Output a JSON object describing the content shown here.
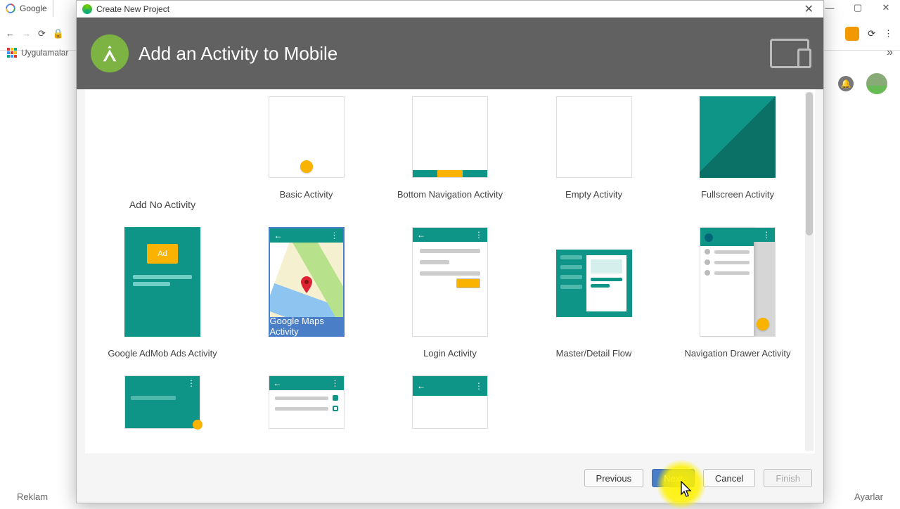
{
  "browser": {
    "tab_label": "Google",
    "bookmarks_label": "Uygulamalar",
    "footer_left": "Reklam",
    "footer_right": "Ayarlar"
  },
  "dialog": {
    "titlebar": "Create New Project",
    "header_title": "Add an Activity to Mobile",
    "selected_index": 6,
    "tiles": [
      {
        "id": "no-activity",
        "label": "Add No Activity",
        "kind": "none"
      },
      {
        "id": "basic",
        "label": "Basic Activity",
        "kind": "basic"
      },
      {
        "id": "bottom-nav",
        "label": "Bottom Navigation Activity",
        "kind": "botnav"
      },
      {
        "id": "empty",
        "label": "Empty Activity",
        "kind": "empty"
      },
      {
        "id": "fullscreen",
        "label": "Fullscreen Activity",
        "kind": "fullscreen"
      },
      {
        "id": "admob",
        "label": "Google AdMob Ads Activity",
        "kind": "admob",
        "ad_text": "Ad"
      },
      {
        "id": "maps",
        "label": "Google Maps Activity",
        "kind": "maps"
      },
      {
        "id": "login",
        "label": "Login Activity",
        "kind": "login"
      },
      {
        "id": "masterdetail",
        "label": "Master/Detail Flow",
        "kind": "masterdetail"
      },
      {
        "id": "navdrawer",
        "label": "Navigation Drawer Activity",
        "kind": "navdrawer"
      },
      {
        "id": "scrolling",
        "label": "",
        "kind": "scrolling"
      },
      {
        "id": "settings",
        "label": "",
        "kind": "settings"
      },
      {
        "id": "tabbed",
        "label": "",
        "kind": "tabbed"
      }
    ],
    "buttons": {
      "previous": "Previous",
      "next": "Next",
      "cancel": "Cancel",
      "finish": "Finish"
    }
  },
  "colors": {
    "teal": "#0f9587",
    "amber": "#f9b300",
    "select": "#4a7ec6",
    "header": "#616161"
  }
}
